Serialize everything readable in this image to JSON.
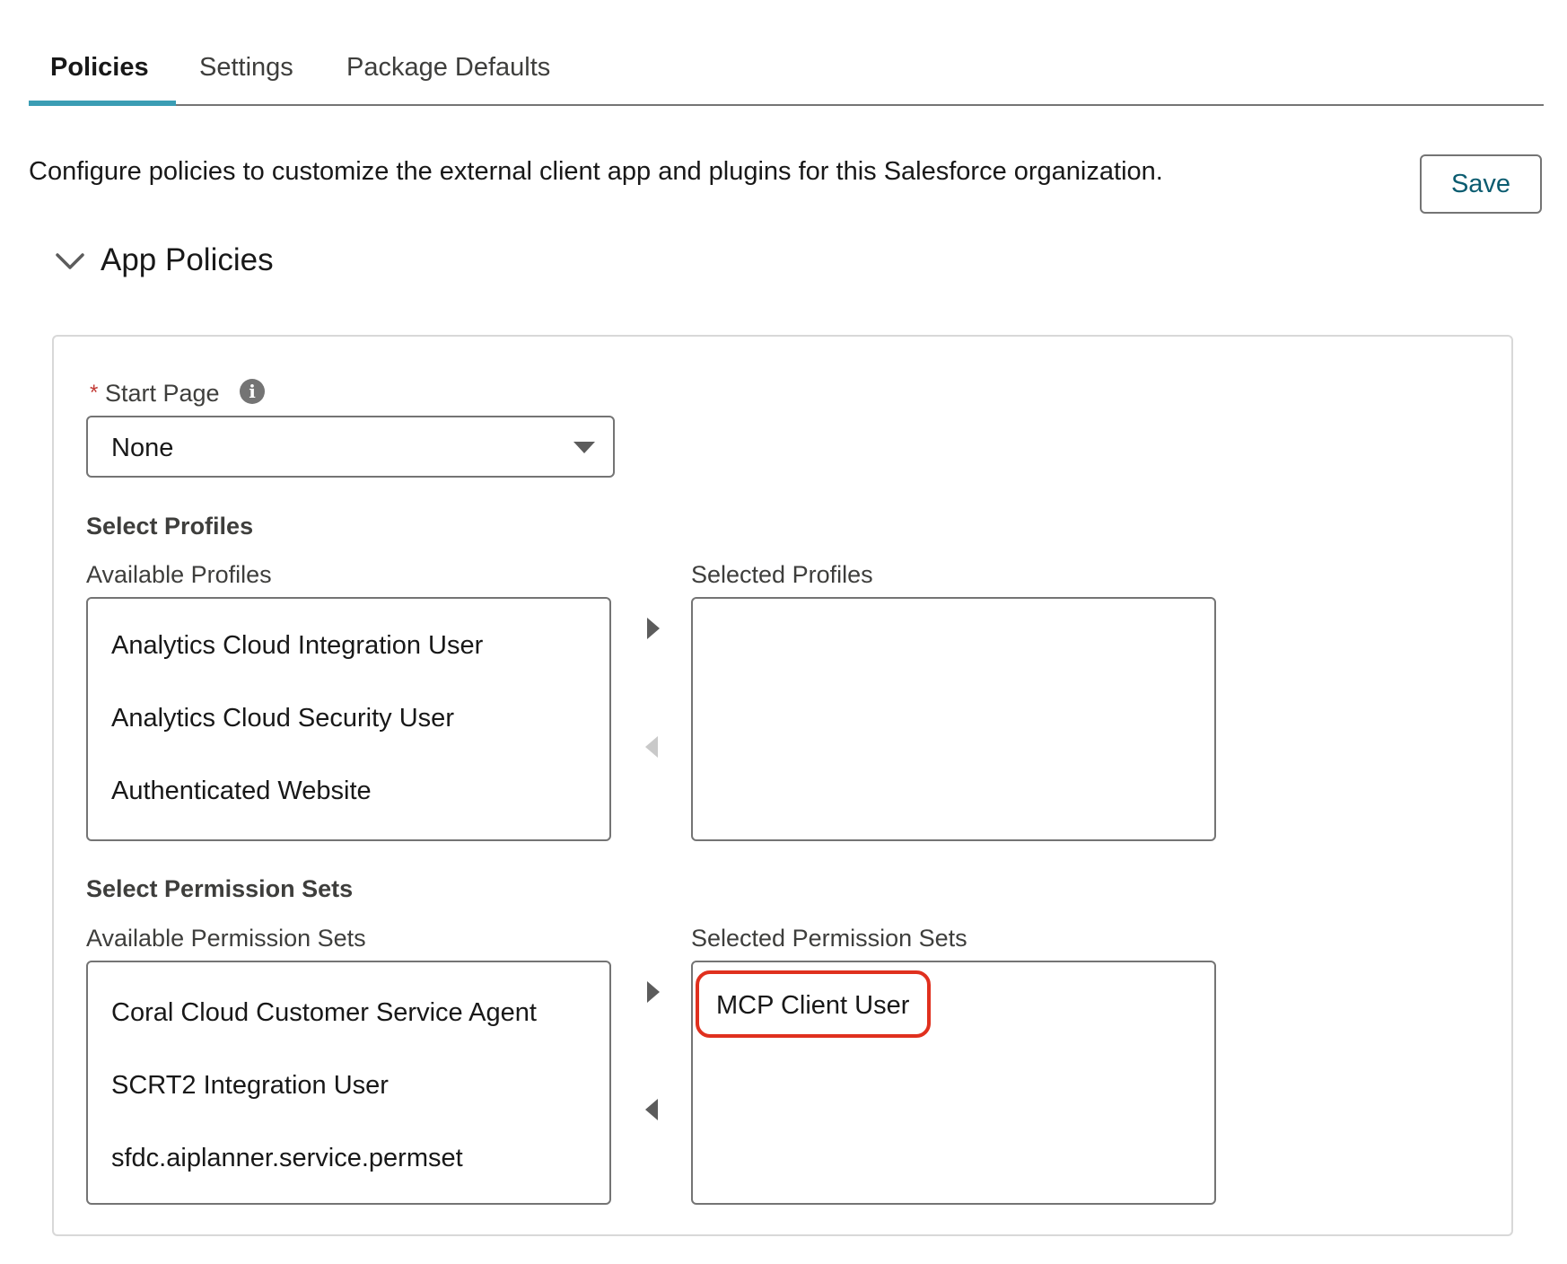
{
  "tabs": [
    {
      "label": "Policies",
      "active": true
    },
    {
      "label": "Settings",
      "active": false
    },
    {
      "label": "Package Defaults",
      "active": false
    }
  ],
  "description": "Configure policies to customize the external client app and plugins for this Salesforce organization.",
  "save_label": "Save",
  "section": {
    "title": "App Policies",
    "expanded": true
  },
  "start_page": {
    "required_marker": "*",
    "label": "Start Page",
    "info_icon": "info-icon",
    "value": "None"
  },
  "profiles": {
    "title": "Select Profiles",
    "available_label": "Available Profiles",
    "selected_label": "Selected Profiles",
    "available": [
      "Analytics Cloud Integration User",
      "Analytics Cloud Security User",
      "Authenticated Website"
    ],
    "selected": []
  },
  "permission_sets": {
    "title": "Select Permission Sets",
    "available_label": "Available Permission Sets",
    "selected_label": "Selected Permission Sets",
    "available": [
      "Coral Cloud Customer Service Agent",
      "SCRT2 Integration User",
      "sfdc.aiplanner.service.permset"
    ],
    "selected": [
      "MCP Client User"
    ]
  },
  "colors": {
    "tab_accent": "#3b9db4",
    "save_text": "#0b5c70",
    "required": "#c23934",
    "highlight": "#e0301e"
  }
}
